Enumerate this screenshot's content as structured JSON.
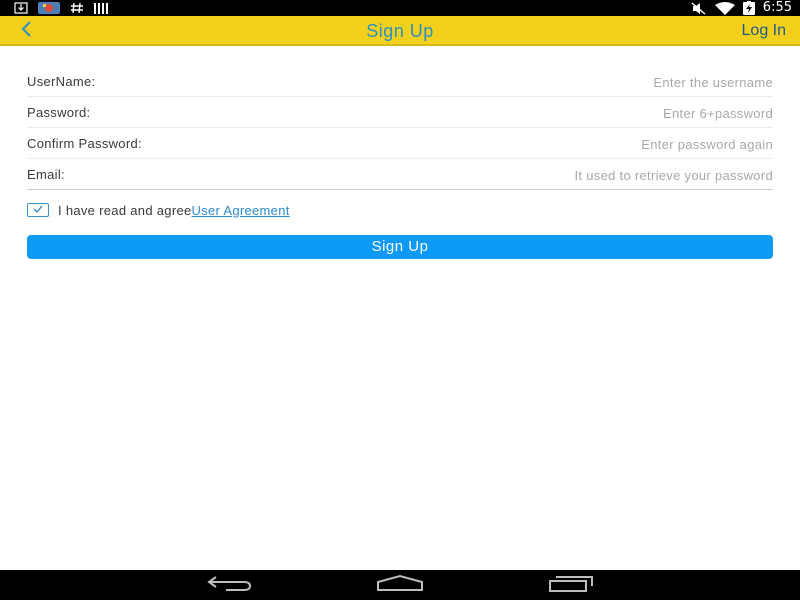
{
  "status_bar": {
    "time": "6:55",
    "left_icons": [
      "download-icon",
      "photo-notification-icon",
      "hash-icon",
      "barcode-icon"
    ],
    "right_icons": [
      "mute-icon",
      "wifi-icon",
      "battery-charging-icon"
    ]
  },
  "toolbar": {
    "title": "Sign Up",
    "login_label": "Log In",
    "background": "#f3d01c",
    "title_color": "#2f8fc2"
  },
  "form": {
    "fields": [
      {
        "label": "UserName:",
        "placeholder": "Enter the username",
        "value": ""
      },
      {
        "label": "Password:",
        "placeholder": "Enter 6+password",
        "value": ""
      },
      {
        "label": "Confirm Password:",
        "placeholder": "Enter password again",
        "value": ""
      },
      {
        "label": "Email:",
        "placeholder": "It used to retrieve your password",
        "value": ""
      }
    ],
    "agreement": {
      "checked": true,
      "text": "I have read and agree",
      "link_text": "User Agreement"
    },
    "submit_label": "Sign Up",
    "submit_color": "#0d9af7"
  },
  "nav_bar": {
    "buttons": [
      "back-nav-icon",
      "home-nav-icon",
      "recents-nav-icon"
    ]
  }
}
